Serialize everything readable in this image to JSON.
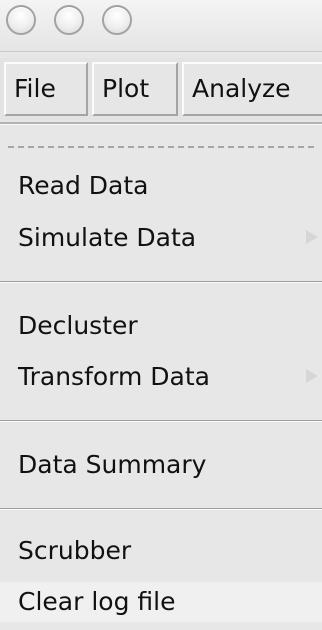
{
  "window": {
    "controls": [
      "close-button",
      "minimize-button",
      "zoom-button"
    ]
  },
  "menubar": {
    "file_label": "File",
    "plot_label": "Plot",
    "analyze_label": "Analyze"
  },
  "menu": {
    "items": [
      {
        "label": "Read Data",
        "submenu": false
      },
      {
        "label": "Simulate Data",
        "submenu": true
      },
      {
        "label": "Decluster",
        "submenu": false
      },
      {
        "label": "Transform Data",
        "submenu": true
      },
      {
        "label": "Data Summary",
        "submenu": false
      },
      {
        "label": "Scrubber",
        "submenu": false
      },
      {
        "label": "Clear log file",
        "submenu": false,
        "highlighted": true
      }
    ]
  }
}
